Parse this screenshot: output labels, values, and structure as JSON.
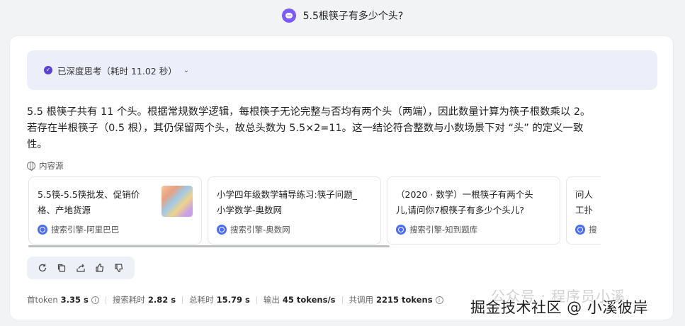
{
  "header": {
    "title": "5.5根筷子有多少个头?"
  },
  "thinking": {
    "label": "已深度思考（耗时 11.02 秒）"
  },
  "answer": {
    "line1": "5.5 根筷子共有 11 个头。根据常规数学逻辑，每根筷子无论完整与否均有两个头（两端），因此数量计算为筷子根数乘以 2。",
    "line2": "若存在半根筷子（0.5 根），其仍保留两个头，故总头数为 5.5×2=11。这一结论符合整数与小数场景下对 “头” 的定义一致",
    "line3": "性。"
  },
  "sources": {
    "label": "内容源",
    "items": [
      {
        "title": "5.5筷-5.5筷批发、促销价格、产地货源",
        "site": "搜索引擎-阿里巴巴"
      },
      {
        "title": "小学四年级数学辅导练习:筷子问题_小学数学-奥数网",
        "site": "搜索引擎-奥数网"
      },
      {
        "title": "（2020 · 数学）一根筷子有两个头儿,请问你7根筷子有多少个头儿?",
        "site": "搜索引擎-知到题库"
      },
      {
        "title": "问人工扑街的",
        "site": "搜"
      }
    ]
  },
  "actions": [
    "refresh-icon",
    "copy-icon",
    "share-icon",
    "thumbs-up-icon",
    "thumbs-down-icon"
  ],
  "stats": {
    "first_token_label": "首token",
    "first_token": "3.35 s",
    "search_label": "搜索耗时",
    "search": "2.82 s",
    "total_label": "总耗时",
    "total": "15.79 s",
    "output_label": "输出",
    "output": "45 tokens/s",
    "calls_label": "共调用",
    "calls": "2215 tokens"
  },
  "watermark": {
    "line1": "公众号 · 程序员小溪",
    "line2": "掘金技术社区 @ 小溪彼岸"
  },
  "colors": {
    "accent": "#5b3fd6",
    "think_bg": "#eceef9",
    "page_bg": "#f2f3f5"
  }
}
